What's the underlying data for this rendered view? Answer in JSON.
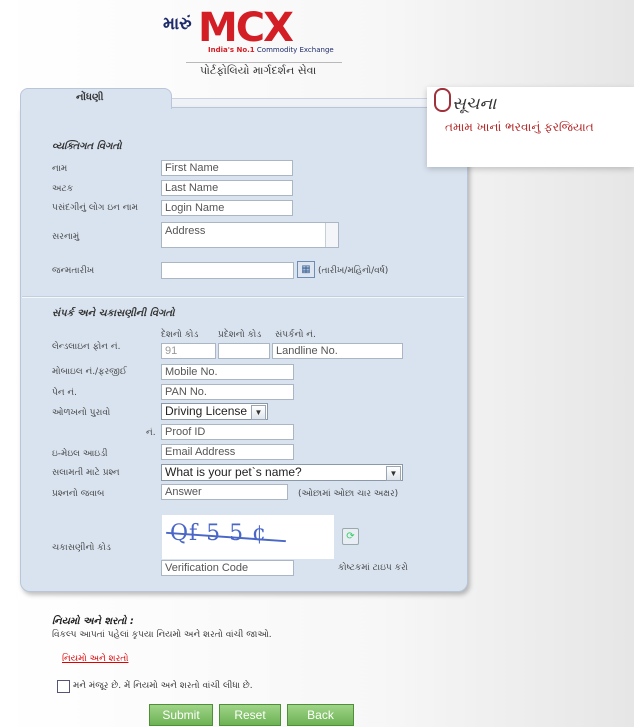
{
  "header": {
    "logo_mark": "મારું",
    "logo_brand": "MCX",
    "logo_tag_strong": "India's No.1",
    "logo_tag": " Commodity Exchange",
    "subtitle": "પોર્ટફોલિયો માર્ગદર્શન સેવા"
  },
  "tab": {
    "label": "નોંધણી"
  },
  "notice": {
    "title": "સૂચના",
    "text": "તમામ ખાનાં ભરવાનું ફરજિયાત"
  },
  "personal": {
    "heading": "વ્યક્તિગત વિગતો",
    "first_name": {
      "label": "નામ",
      "placeholder": "First Name"
    },
    "last_name": {
      "label": "અટક",
      "placeholder": "Last Name"
    },
    "login_name": {
      "label": "પસંદગીનું લોગ ઇન નામ",
      "placeholder": "Login Name"
    },
    "address": {
      "label": "સરનામું",
      "placeholder": "Address"
    },
    "dob": {
      "label": "જન્મતારીખ",
      "hint": "(તારીખ/મહિનો/વર્ષ)"
    }
  },
  "contact": {
    "heading": "સંપર્ક અને ચકાસણીની વિગતો",
    "sub_labels": [
      "દેશનો કોડ",
      "પ્રદેશનો કોડ",
      "સંપર્કનો નં."
    ],
    "landline": {
      "label": "લેન્ડલાઇન ફોન નં.",
      "country_code": "91",
      "number": "Landline No."
    },
    "mobile": {
      "label": "મોબાઇલ નં./ફરજીઈ",
      "placeholder": "Mobile No."
    },
    "pan": {
      "label": "પેન નં.",
      "placeholder": "PAN No."
    },
    "id_proof": {
      "label": "ઓળખનો પુરાવો",
      "selected": "Driving License"
    },
    "proof_id": {
      "label": "નં.",
      "placeholder": "Proof ID"
    },
    "email": {
      "label": "ઇ-મેઇલ આઇડી",
      "placeholder": "Email Address"
    },
    "security_q": {
      "label": "સલામતી માટે પ્રશ્ન",
      "selected": "What is your pet`s name?"
    },
    "answer": {
      "label": "પ્રશ્નનો જવાબ",
      "placeholder": "Answer",
      "hint": "(ઓછામાં ઓછા ચાર અક્ષર)"
    },
    "captcha": {
      "label": "ચકાસણીનો કોડ",
      "text": "Qf 5 5 ¢",
      "placeholder": "Verification Code",
      "hint": "કોષ્ટકમાં ટાઇપ કરો"
    }
  },
  "terms": {
    "heading": "નિયમો અને શરતો :",
    "text": "વિકલ્પ આપતાં પહેલાં કૃપયા નિયમો અને શરતો વાંચી જાઓ.",
    "link": "નિયમો અને શરતો",
    "agree": "મને મંજૂર છે. મેં નિયમો અને શરતો વાંચી લીધા છે."
  },
  "buttons": {
    "submit": "Submit",
    "reset": "Reset",
    "back": "Back"
  }
}
